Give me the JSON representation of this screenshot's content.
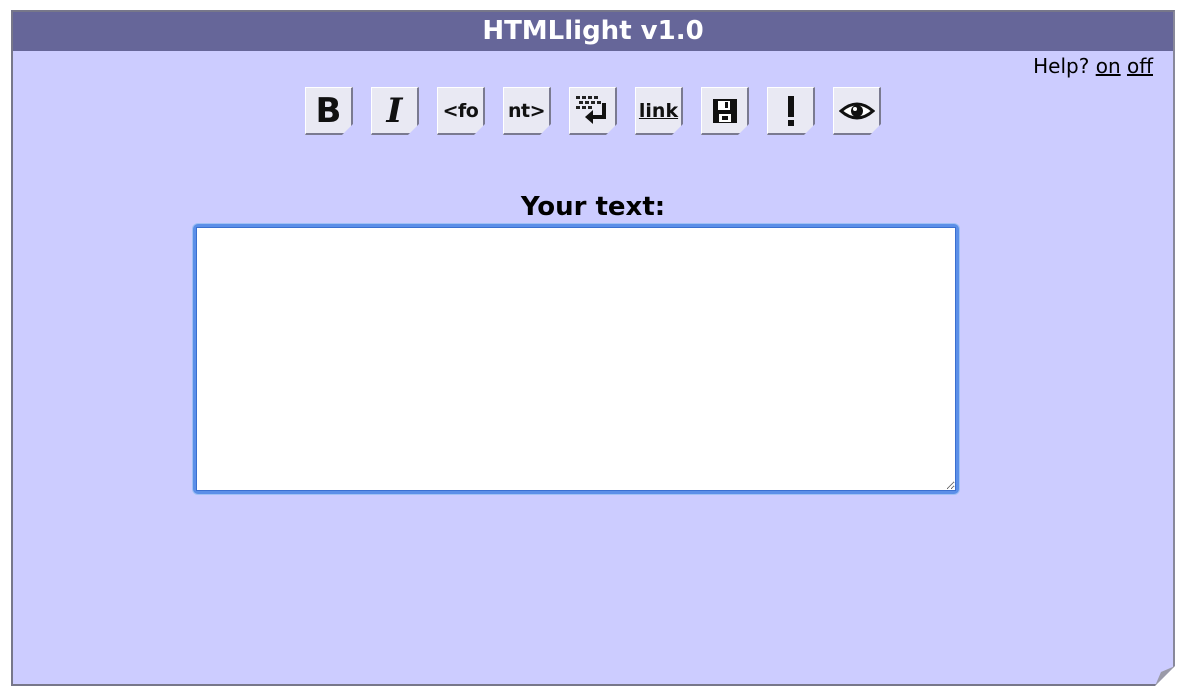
{
  "app": {
    "title": "HTMLlight v1.0"
  },
  "help": {
    "label": "Help?",
    "on": "on",
    "off": "off"
  },
  "toolbar": {
    "bold": "B",
    "italic": "I",
    "font_open": "<fo",
    "font_close": "nt>",
    "link": "link"
  },
  "editor": {
    "label": "Your text:",
    "value": ""
  },
  "colors": {
    "title_bar": "#666699",
    "panel": "#ccccff",
    "focus_ring": "#5b8fe8"
  }
}
